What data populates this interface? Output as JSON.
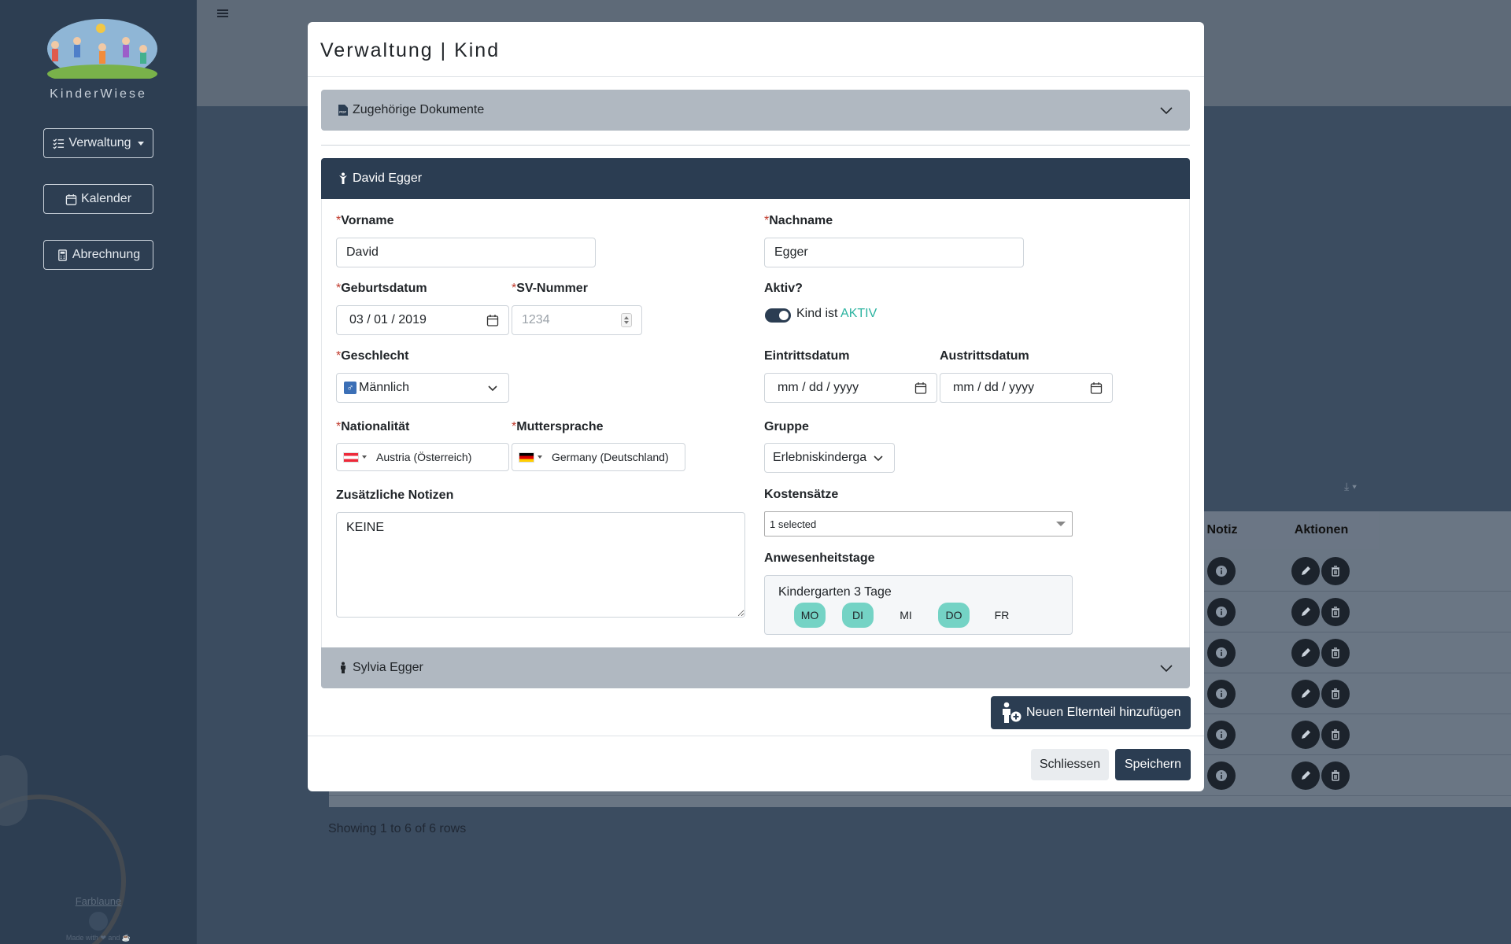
{
  "sidebar": {
    "brand": "KinderWiese",
    "buttons": [
      {
        "label": "Verwaltung",
        "icon": "list-check-icon"
      },
      {
        "label": "Kalender",
        "icon": "calendar-icon"
      },
      {
        "label": "Abrechnung",
        "icon": "calculator-icon"
      }
    ],
    "footer_link": "Farblaune",
    "made_with": "Made with ❤ and ☕"
  },
  "background": {
    "table_headers": [
      "Notiz",
      "Aktionen"
    ],
    "row_count": 6,
    "showing_text": "Showing 1 to 6 of 6 rows"
  },
  "modal": {
    "title": "Verwaltung | Kind",
    "documents_section": "Zugehörige Dokumente",
    "child_section": "David Egger",
    "parent_section": "Sylvia Egger",
    "fields": {
      "vorname": {
        "label": "Vorname",
        "value": "David"
      },
      "nachname": {
        "label": "Nachname",
        "value": "Egger"
      },
      "geburtsdatum": {
        "label": "Geburtsdatum",
        "value": "03 / 01 / 2019"
      },
      "sv_nummer": {
        "label": "SV-Nummer",
        "placeholder": "1234"
      },
      "aktiv": {
        "label": "Aktiv?",
        "text": "Kind ist",
        "status": "AKTIV",
        "checked": true
      },
      "geschlecht": {
        "label": "Geschlecht",
        "value": "Männlich"
      },
      "eintritt": {
        "label": "Eintrittsdatum",
        "value": "mm / dd / yyyy"
      },
      "austritt": {
        "label": "Austrittsdatum",
        "value": "mm / dd / yyyy"
      },
      "nationalitaet": {
        "label": "Nationalität",
        "value": "Austria (Österreich)"
      },
      "muttersprache": {
        "label": "Muttersprache",
        "value": "Germany (Deutschland)"
      },
      "gruppe": {
        "label": "Gruppe",
        "value": "Erlebniskinderga"
      },
      "notizen": {
        "label": "Zusätzliche Notizen",
        "value": "KEINE"
      },
      "kostensaetze": {
        "label": "Kostensätze",
        "value": "1 selected"
      },
      "anwesenheit": {
        "label": "Anwesenheitstage",
        "plan": "Kindergarten 3 Tage",
        "days": [
          {
            "label": "MO",
            "active": true
          },
          {
            "label": "DI",
            "active": true
          },
          {
            "label": "MI",
            "active": false
          },
          {
            "label": "DO",
            "active": true
          },
          {
            "label": "FR",
            "active": false
          }
        ]
      }
    },
    "required_mark": "*",
    "add_parent_label": "Neuen Elternteil hinzufügen",
    "close_label": "Schliessen",
    "save_label": "Speichern"
  }
}
